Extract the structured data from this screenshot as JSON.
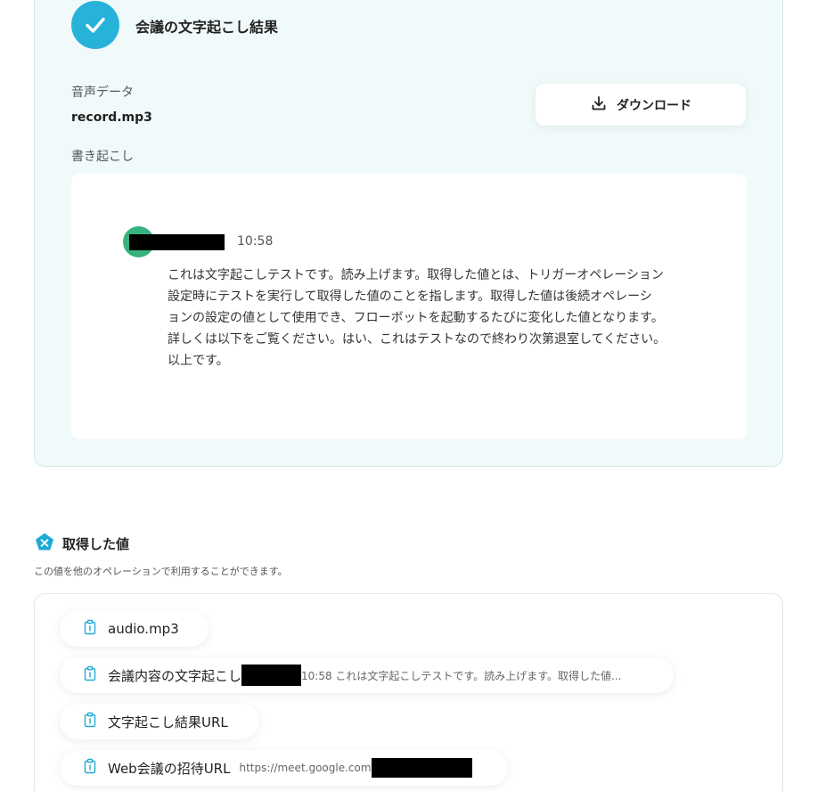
{
  "result": {
    "title": "会議の文字起こし結果",
    "audio_label": "音声データ",
    "filename": "record.mp3",
    "transcript_label": "書き起こし",
    "download_label": "ダウンロード",
    "timestamp": "10:58",
    "transcript_lines": [
      "これは文字起こしテストです。読み上げます。取得した値とは、トリガーオペレーション",
      "設定時にテストを実行して取得した値のことを指します。取得した値は後続オペレーシ",
      "ョンの設定の値として使用でき、フローボットを起動するたびに変化した値となります。",
      "詳しくは以下をご覧ください。はい、これはテストなので終わり次第退室してください。",
      "以上です。"
    ]
  },
  "values": {
    "title": "取得した値",
    "description": "この値を他のオペレーションで利用することができます。",
    "items": [
      {
        "name": "audio.mp3",
        "value": ""
      },
      {
        "name": "会議内容の文字起こし",
        "value": "10:58 これは文字起こしテストです。読み上げます。取得した値..."
      },
      {
        "name": "文字起こし結果URL",
        "value": ""
      },
      {
        "name": "Web会議の招待URL",
        "value": "https://meet.google.com"
      }
    ]
  },
  "colors": {
    "card_bg": "#f1fafa",
    "check_badge": "#27b3d9",
    "avatar": "#36b37e",
    "values_icon": "#1fa9d6"
  },
  "icons": {
    "result_badge": "check-icon",
    "download": "download-icon",
    "values_header": "variable-icon",
    "pill": "clipboard-icon"
  }
}
